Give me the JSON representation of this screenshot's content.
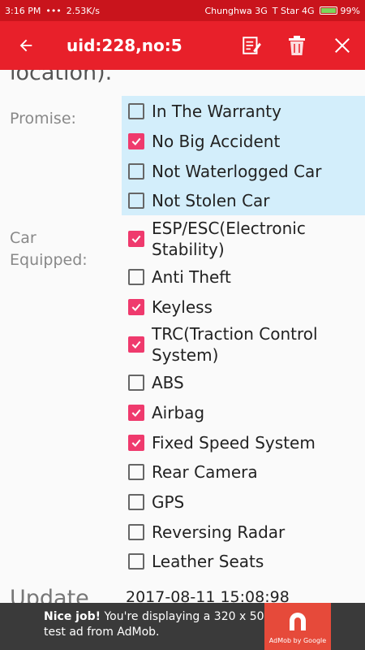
{
  "status_bar": {
    "time": "3:16 PM",
    "dots": "•••",
    "speed": "2.53K/s",
    "carrier1": "Chunghwa 3G",
    "carrier2": "T Star 4G",
    "battery": "99%"
  },
  "app_bar": {
    "title": "uid:228,no:5",
    "icons": [
      "back-arrow-icon",
      "edit-icon",
      "trash-icon",
      "close-icon"
    ]
  },
  "form": {
    "cut_text": "location).",
    "promise_label": "Promise:",
    "promise_options": [
      {
        "label": "In The Warranty",
        "checked": false
      },
      {
        "label": "No Big Accident",
        "checked": true
      },
      {
        "label": "Not Waterlogged Car",
        "checked": false
      },
      {
        "label": "Not Stolen Car",
        "checked": false
      }
    ],
    "equipped_label_line1": "Car",
    "equipped_label_line2": "Equipped:",
    "equipped_options": [
      {
        "label": "ESP/ESC(Electronic",
        "label2": "Stability)",
        "checked": true
      },
      {
        "label": "Anti Theft",
        "checked": false
      },
      {
        "label": "Keyless",
        "checked": true
      },
      {
        "label": "TRC(Traction Control",
        "label2": "System)",
        "checked": true
      },
      {
        "label": "ABS",
        "checked": false
      },
      {
        "label": "Airbag",
        "checked": true
      },
      {
        "label": "Fixed Speed System",
        "checked": true
      },
      {
        "label": "Rear Camera",
        "checked": false
      },
      {
        "label": "GPS",
        "checked": false
      },
      {
        "label": "Reversing Radar",
        "checked": false
      },
      {
        "label": "Leather Seats",
        "checked": false
      }
    ],
    "update_label": "Update",
    "update_value": "2017-08-11 15:08:98"
  },
  "ad": {
    "bold": "Nice job!",
    "text": " You're displaying a 320 x 50 test ad from AdMob.",
    "logo_text": "AdMob by Google"
  },
  "colors": {
    "status_bar": "#c9141c",
    "app_bar": "#e8202a",
    "checkbox_checked": "#ef3a6d",
    "promise_bg": "#d3eefb"
  }
}
